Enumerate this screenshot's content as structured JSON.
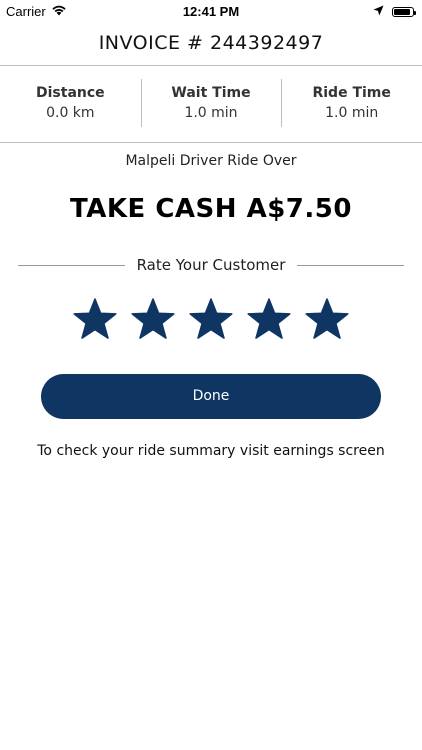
{
  "status_bar": {
    "carrier": "Carrier",
    "time": "12:41 PM",
    "battery_level": 0.9
  },
  "invoice": {
    "title": "INVOICE # 244392497"
  },
  "stats": [
    {
      "label": "Distance",
      "value": "0.0 km"
    },
    {
      "label": "Wait Time",
      "value": "1.0 min"
    },
    {
      "label": "Ride Time",
      "value": "1.0 min"
    }
  ],
  "ride": {
    "status_text": "Malpeli Driver Ride Over",
    "cash_text": "TAKE CASH A$7.50"
  },
  "rating": {
    "label": "Rate Your Customer",
    "max_stars": 5,
    "selected_stars": 5,
    "star_color": "#0f3563"
  },
  "actions": {
    "done_label": "Done",
    "accent_color": "#0f3563"
  },
  "hint": {
    "text": "To check your ride summary visit earnings screen"
  }
}
